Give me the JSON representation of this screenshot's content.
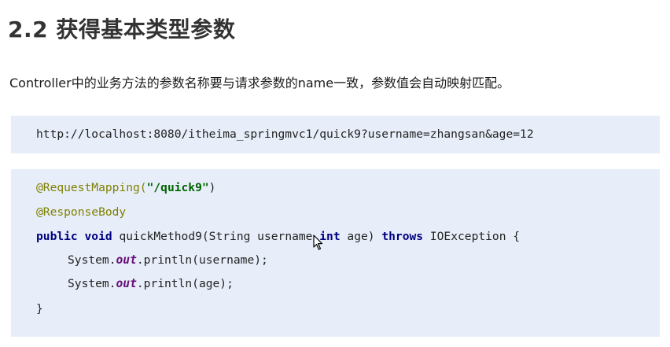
{
  "heading": "2.2 获得基本类型参数",
  "description": "Controller中的业务方法的参数名称要与请求参数的name一致，参数值会自动映射匹配。",
  "url_example": "http://localhost:8080/itheima_springmvc1/quick9?username=zhangsan&age=12",
  "code": {
    "line1_annotation": "@RequestMapping(",
    "line1_string": "\"/quick9\"",
    "line1_close": ")",
    "line2_annotation": "@ResponseBody",
    "line3_kw_public": "public",
    "line3_kw_void": "void",
    "line3_method": " quickMethod9(String username,",
    "line3_kw_int": "int",
    "line3_age": " age) ",
    "line3_kw_throws": "throws",
    "line3_exception": " IOException {",
    "line4_prefix": "System.",
    "line4_field": "out",
    "line4_suffix": ".println(username);",
    "line5_prefix": "System.",
    "line5_field": "out",
    "line5_suffix": ".println(age);",
    "line6_close": "}"
  },
  "colors": {
    "code_background": "#e7eef9",
    "annotation": "#808000",
    "string": "#006400",
    "keyword": "#000080",
    "field": "#660e7a"
  },
  "icons": {
    "cursor": "mouse-pointer-icon"
  }
}
